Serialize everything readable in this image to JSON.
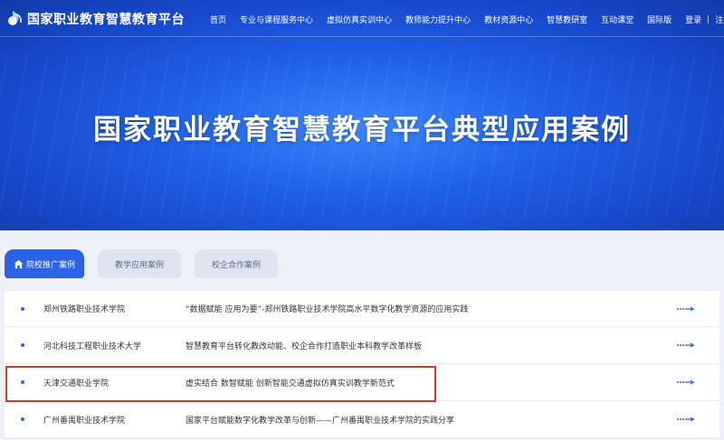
{
  "header": {
    "site_title": "国家职业教育智慧教育平台",
    "nav": [
      {
        "label": "首页"
      },
      {
        "label": "专业与课程服务中心"
      },
      {
        "label": "虚拟仿真实训中心"
      },
      {
        "label": "教师能力提升中心"
      },
      {
        "label": "教材资源中心"
      },
      {
        "label": "智慧教研室"
      },
      {
        "label": "互动课堂"
      },
      {
        "label": "国际版"
      }
    ],
    "login": "登录",
    "register": "注册",
    "separator": "|"
  },
  "hero": {
    "title": "国家职业教育智慧教育平台典型应用案例"
  },
  "tabs": [
    {
      "label": "院校推广案例",
      "active": true
    },
    {
      "label": "教学应用案例",
      "active": false
    },
    {
      "label": "校企合作案例",
      "active": false
    }
  ],
  "cases": [
    {
      "school": "郑州铁路职业技术学院",
      "title": "“数据赋能 应用为要”-郑州铁路职业技术学院高水平数字化教学资源的应用实践",
      "more": "more-arrow-icon"
    },
    {
      "school": "河北科技工程职业技术大学",
      "title": "智慧教育平台转化教改动能、校企合作打造职业本科教学改革样板",
      "more": "more-arrow-icon"
    },
    {
      "school": "天津交通职业学院",
      "title": "虚实结合 数智赋能 创新智能交通虚拟仿真实训教学新范式",
      "more": "more-arrow-icon"
    },
    {
      "school": "广州番禺职业技术学院",
      "title": "国家平台赋能数字化教学改革与创新——广州番禺职业技术学院的实践分享",
      "more": "more-arrow-icon"
    }
  ],
  "colors": {
    "accent": "#2a63e6",
    "highlight_border": "#e0362a",
    "hero_blue": "#1f5fe6"
  }
}
